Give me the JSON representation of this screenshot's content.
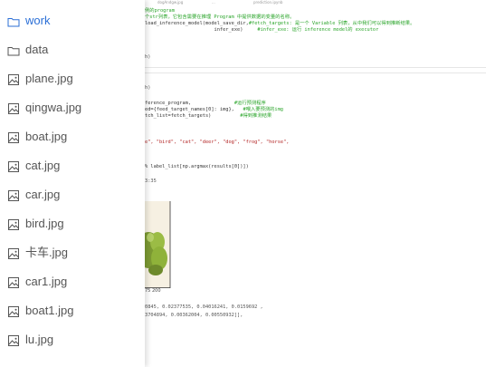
{
  "sidebar": {
    "items": [
      {
        "label": "work",
        "type": "folder",
        "active": true
      },
      {
        "label": "data",
        "type": "folder",
        "active": false
      },
      {
        "label": "plane.jpg",
        "type": "image",
        "active": false
      },
      {
        "label": "qingwa.jpg",
        "type": "image",
        "active": false
      },
      {
        "label": "boat.jpg",
        "type": "image",
        "active": false
      },
      {
        "label": "cat.jpg",
        "type": "image",
        "active": false
      },
      {
        "label": "car.jpg",
        "type": "image",
        "active": false
      },
      {
        "label": "bird.jpg",
        "type": "image",
        "active": false
      },
      {
        "label": "卡车.jpg",
        "type": "image",
        "active": false
      },
      {
        "label": "car1.jpg",
        "type": "image",
        "active": false
      },
      {
        "label": "boat1.jpg",
        "type": "image",
        "active": false
      },
      {
        "label": "lu.jpg",
        "type": "image",
        "active": false
      }
    ],
    "active_color": "#2b6fd6",
    "text_color": "#555555"
  },
  "notebook": {
    "top_strip": [
      "dogAndgw.jpg",
      "...",
      "prediction.ipynb"
    ],
    "cell1": [
      {
        "segs": [
          {
            "t": "c",
            "v": "例的program"
          }
        ]
      },
      {
        "segs": [
          {
            "t": "c",
            "v": "个str列表，它包含需要在推理 Program 中提供数据的变量的名称。"
          }
        ]
      },
      {
        "segs": [
          {
            "t": "n",
            "v": "load_inference_model(model_save_dir,"
          },
          {
            "t": "c",
            "v": "#fetch_targets: 是一个 Variable 列表，从中我们可以得到推断结果。"
          }
        ]
      },
      {
        "segs": [
          {
            "t": "n",
            "v": "                        infer_exe)     "
          },
          {
            "t": "c",
            "v": "#infer_exe: 运行 inference model的 executor"
          }
        ]
      }
    ],
    "cell1_out": "h)",
    "cell2_out": "h)",
    "cell3": [
      {
        "segs": [
          {
            "t": "n",
            "v": "ference_program,               "
          },
          {
            "t": "c",
            "v": "#运行预测程序"
          }
        ]
      },
      {
        "segs": [
          {
            "t": "n",
            "v": "ed={feed_target_names[0]: img},   "
          },
          {
            "t": "c",
            "v": "#喂入要预测的img"
          }
        ]
      },
      {
        "segs": [
          {
            "t": "n",
            "v": "tch_list=fetch_targets)          "
          },
          {
            "t": "c",
            "v": "#得到推测结果"
          }
        ]
      }
    ],
    "labels_line": "e\", \"bird\", \"cat\", \"deer\", \"dog\", \"frog\", \"horse\",",
    "print_line": "% label_list[np.argmax(results[0])])",
    "timestamp": "3:35",
    "axis_ticks": "75   200",
    "result_lines": [
      "0845, 0.02377535, 0.04016241, 0.0159692 ,",
      "3704894, 0.00362004, 0.00550932]],"
    ]
  }
}
